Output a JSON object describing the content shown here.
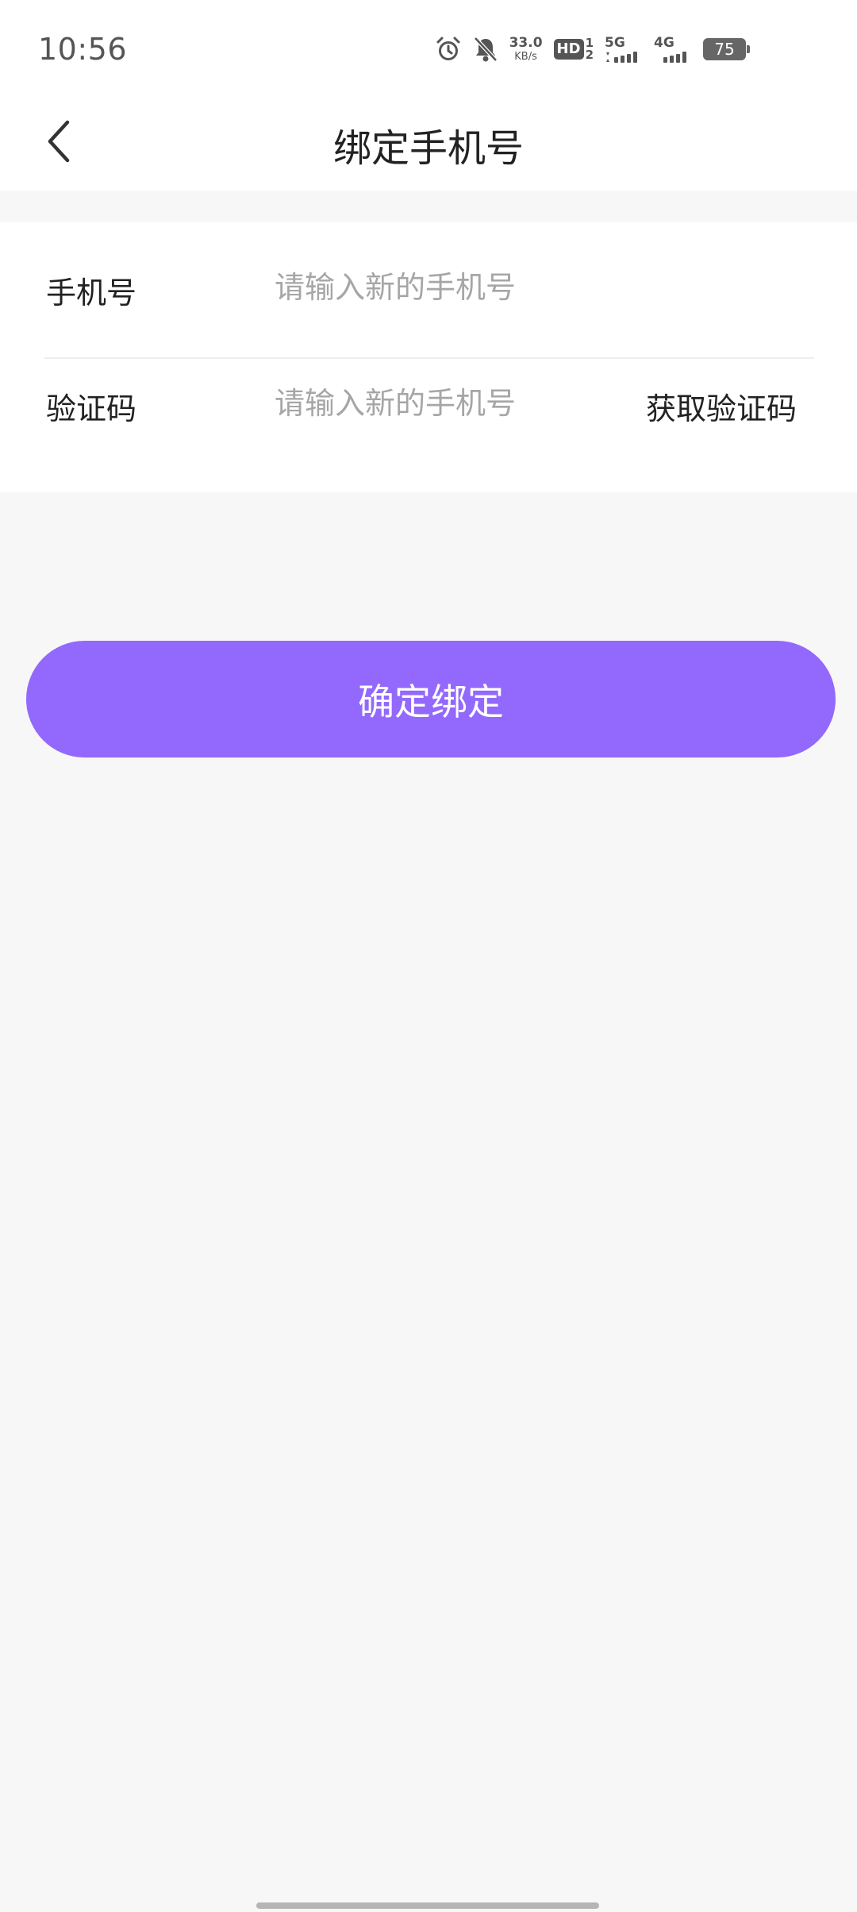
{
  "status_bar": {
    "time": "10:56",
    "net_speed_value": "33.0",
    "net_speed_unit": "KB/s",
    "hd_label": "HD",
    "sim1": "1",
    "sim2": "2",
    "network_5g": "5G",
    "network_4g": "4G",
    "battery": "75",
    "icons": [
      "alarm-icon",
      "bell-off-icon",
      "hd-icon",
      "signal-5g-icon",
      "signal-4g-icon",
      "battery-icon"
    ]
  },
  "header": {
    "title": "绑定手机号",
    "back_icon": "chevron-left-icon"
  },
  "form": {
    "phone_label": "手机号",
    "phone_placeholder": "请输入新的手机号",
    "phone_value": "",
    "code_label": "验证码",
    "code_placeholder": "请输入新的手机号",
    "code_value": "",
    "get_code_label": "获取验证码"
  },
  "confirm_button": {
    "label": "确定绑定"
  },
  "colors": {
    "accent": "#9269fc",
    "background": "#f7f7f7",
    "surface": "#ffffff",
    "text_primary": "#222222",
    "placeholder": "#a6a6a6"
  }
}
